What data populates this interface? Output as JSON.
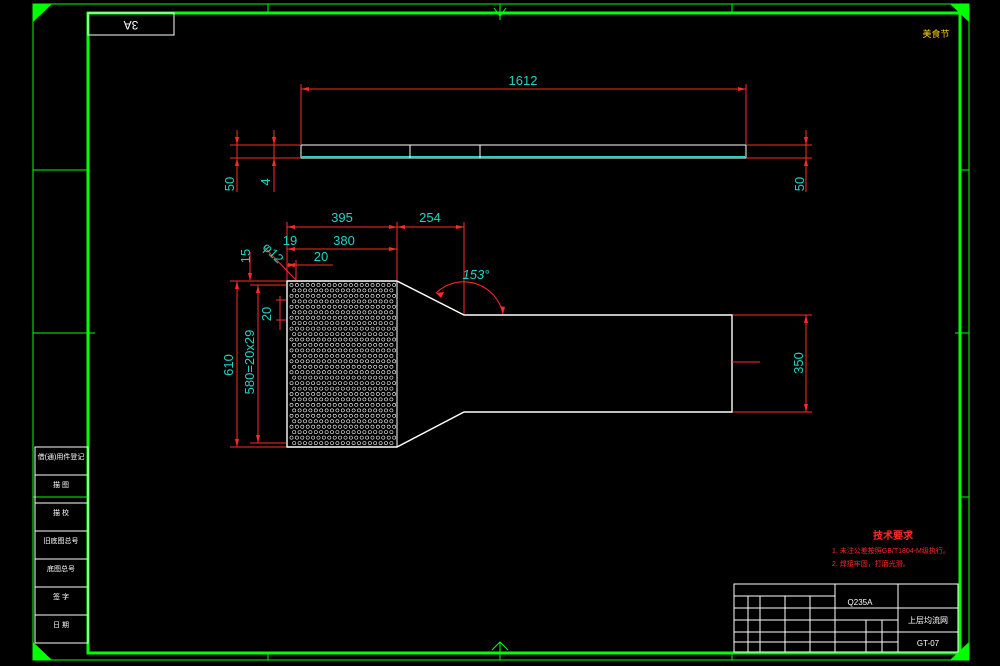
{
  "corner_label": "3A",
  "stamp_label": "美食节",
  "top_view": {
    "length_dim": "1612",
    "left_dims": [
      "50",
      "4"
    ],
    "right_dim": "50"
  },
  "plan_view": {
    "dims": {
      "d395": "395",
      "d254": "254",
      "d19": "19",
      "d380": "380",
      "phi12": "φ12",
      "d20_top": "20",
      "d15": "15",
      "d20_left": "20",
      "d610": "610",
      "d580": "580=20x29",
      "d350": "350",
      "angle": "153°"
    }
  },
  "left_table": [
    "借(通)用件登记",
    "描 图",
    "描 校",
    "旧底图总号",
    "底图总号",
    "签 字",
    "日 期"
  ],
  "tech_req": {
    "title": "技术要求",
    "lines": [
      "1. 未注公差按照GB/T1804-M级执行。",
      "2. 焊接牢固，打磨光滑。"
    ]
  },
  "title_block": {
    "material": "Q235A",
    "part_name": "上层均流网",
    "drawing_no": "GT-07"
  },
  "colors": {
    "frame": "#00ff00",
    "outline": "#ffffff",
    "dimension": "#ff2a2a",
    "dim_text": "#22d3c5"
  }
}
